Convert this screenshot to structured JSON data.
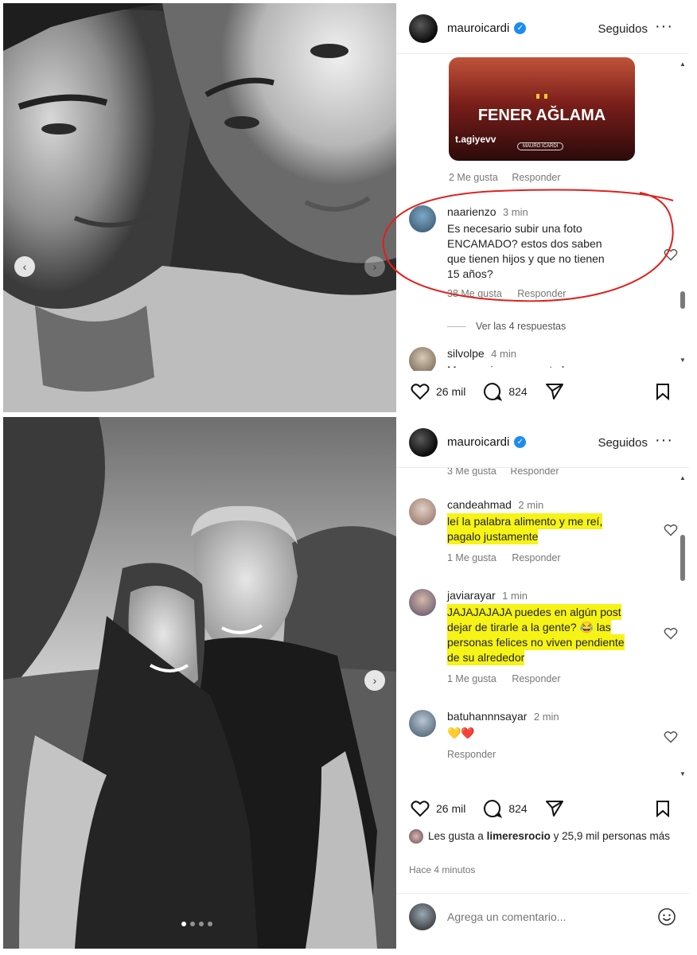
{
  "post1": {
    "username": "mauroicardi",
    "follow_label": "Seguidos",
    "more_label": "···",
    "image_caption": {
      "title": "FENER AĞLAMA",
      "handle": "t.agiyevv",
      "badge": "MAURO ICARDI"
    },
    "prev_comment_meta": {
      "likes": "2 Me gusta",
      "reply": "Responder"
    },
    "comments": [
      {
        "user": "naarienzo",
        "time": "3 min",
        "text": "Es necesario subir una foto ENCAMADO? estos dos saben que tienen hijos y que no tienen 15 años?",
        "likes": "38 Me gusta",
        "reply": "Responder"
      }
    ],
    "view_replies": "Ver las 4 respuestas",
    "partial_comment": {
      "user": "silvolpe",
      "time": "4 min",
      "text": "Mauro, siempre que te leo veo"
    },
    "like_count": "26 mil",
    "comment_count": "824"
  },
  "post2": {
    "username": "mauroicardi",
    "follow_label": "Seguidos",
    "more_label": "···",
    "prev_comment_meta": {
      "likes": "3 Me gusta",
      "reply": "Responder"
    },
    "comments": [
      {
        "user": "candeahmad",
        "time": "2 min",
        "text": "leí la palabra alimento y me reí, pagalo justamente",
        "likes": "1 Me gusta",
        "reply": "Responder"
      },
      {
        "user": "javiarayar",
        "time": "1 min",
        "text": "JAJAJAJAJA puedes en algún post dejar de tirarle a la gente? 😂 las personas felices no viven pendiente de su alrededor",
        "likes": "1 Me gusta",
        "reply": "Responder"
      },
      {
        "user": "batuhannnsayar",
        "time": "2 min",
        "text": "💛❤️",
        "reply": "Responder"
      }
    ],
    "like_count": "26 mil",
    "comment_count": "824",
    "liked_by_prefix": "Les gusta a",
    "liked_by_user": "limeresrocio",
    "liked_by_suffix": "y 25,9 mil personas más",
    "posted_time": "Hace 4 minutos",
    "comment_placeholder": "Agrega un comentario...",
    "emoji_icon": "smiley-icon"
  },
  "colors": {
    "verified": "#1d8bf1",
    "highlight": "#f6f316",
    "annotation_circle": "#e0201c"
  }
}
